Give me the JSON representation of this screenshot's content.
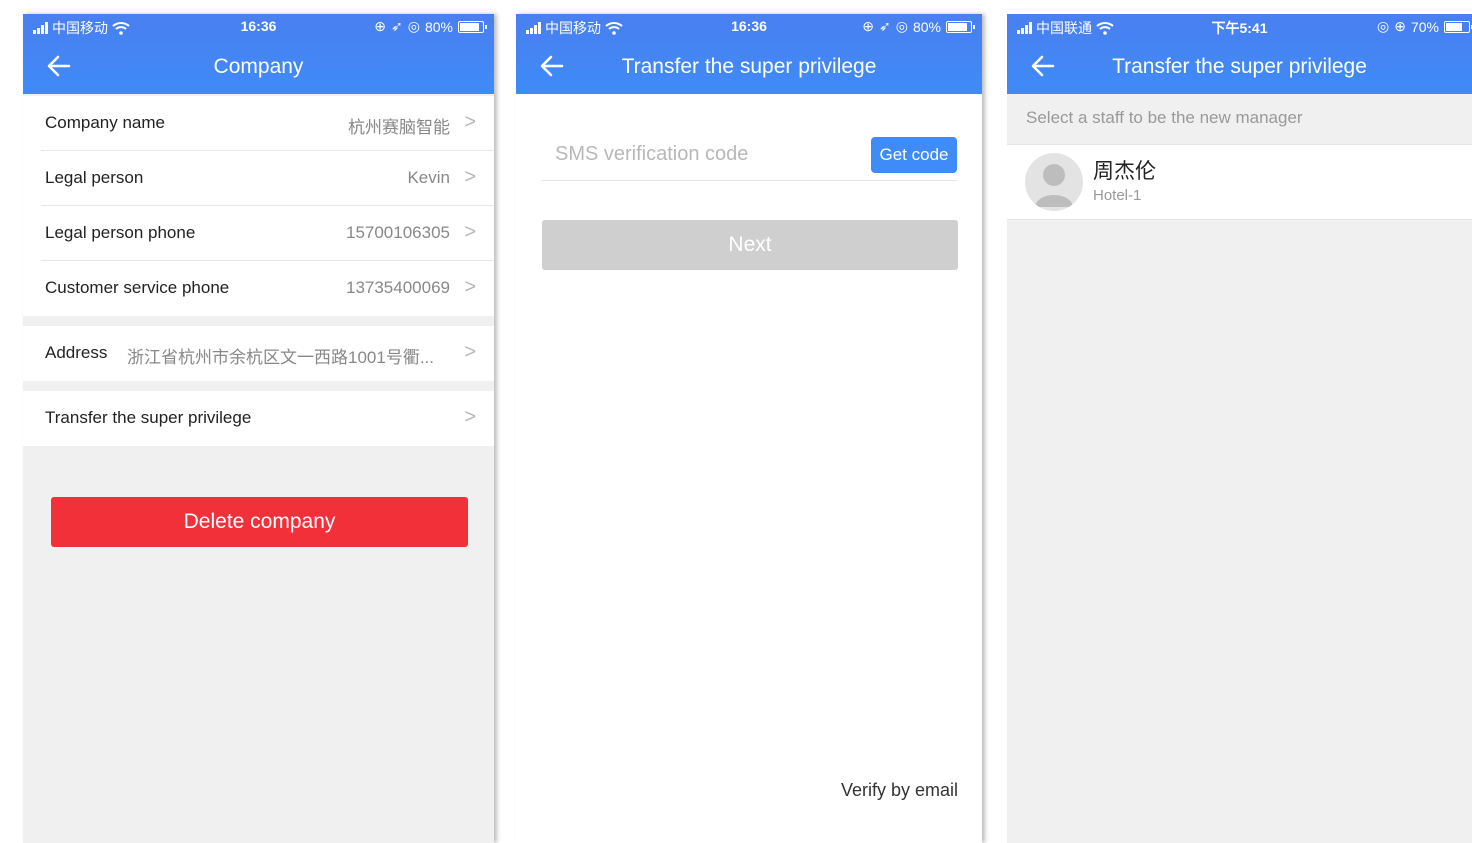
{
  "screens": {
    "company": {
      "status": {
        "carrier": "中国移动",
        "time": "16:36",
        "battery": "80%",
        "battery_level": 0.8
      },
      "title": "Company",
      "rows": [
        {
          "label": "Company name",
          "value": "杭州赛脑智能"
        },
        {
          "label": "Legal person",
          "value": "Kevin"
        },
        {
          "label": "Legal person phone",
          "value": "15700106305"
        },
        {
          "label": "Customer service phone",
          "value": "13735400069"
        }
      ],
      "address": {
        "label": "Address",
        "value": "浙江省杭州市余杭区文一西路1001号衢..."
      },
      "transfer": {
        "label": "Transfer the super privilege"
      },
      "delete_label": "Delete company"
    },
    "sms": {
      "status": {
        "carrier": "中国移动",
        "time": "16:36",
        "battery": "80%",
        "battery_level": 0.8
      },
      "title": "Transfer the super privilege",
      "sms_placeholder": "SMS verification code",
      "get_code_label": "Get code",
      "next_label": "Next",
      "verify_email_label": "Verify by email"
    },
    "staff": {
      "status": {
        "carrier": "中国联通",
        "time": "下午5:41",
        "battery": "70%",
        "battery_level": 0.7
      },
      "title": "Transfer the super privilege",
      "hint": "Select a staff to be the new manager",
      "staff_list": [
        {
          "name": "周杰伦",
          "dept": "Hotel-1"
        }
      ]
    }
  },
  "colors": {
    "nav": "#3f8bf7",
    "danger": "#f2303a",
    "disabled": "#cfcfcf"
  },
  "icons": [
    "signal-icon",
    "wifi-icon",
    "alarm-icon",
    "location-icon",
    "battery-icon",
    "back-arrow-icon",
    "chevron-right-icon",
    "avatar-placeholder-icon"
  ]
}
